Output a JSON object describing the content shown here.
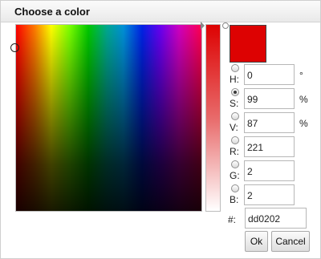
{
  "dialog": {
    "title": "Choose a color"
  },
  "preview": {
    "color": "#dd0202"
  },
  "fields": [
    {
      "key": "H",
      "label": "H:",
      "value": "0",
      "unit": "°",
      "selected": false
    },
    {
      "key": "S",
      "label": "S:",
      "value": "99",
      "unit": "%",
      "selected": true
    },
    {
      "key": "V",
      "label": "V:",
      "value": "87",
      "unit": "%",
      "selected": false
    },
    {
      "key": "R",
      "label": "R:",
      "value": "221",
      "unit": "",
      "selected": false
    },
    {
      "key": "G",
      "label": "G:",
      "value": "2",
      "unit": "",
      "selected": false
    },
    {
      "key": "B",
      "label": "B:",
      "value": "2",
      "unit": "",
      "selected": false
    }
  ],
  "hex": {
    "label": "#:",
    "value": "dd0202"
  },
  "buttons": {
    "ok": "Ok",
    "cancel": "Cancel"
  }
}
